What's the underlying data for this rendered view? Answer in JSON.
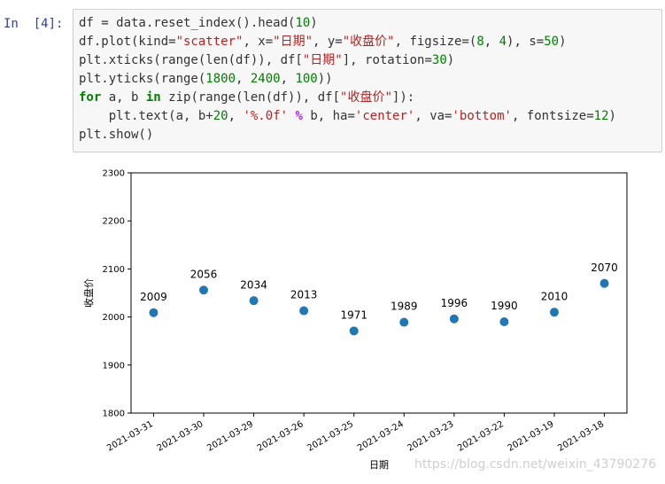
{
  "cell": {
    "prompt": "In  [4]:",
    "code_lines": [
      [
        [
          "df = data.reset_index().head(",
          "txt"
        ],
        [
          "10",
          "num"
        ],
        [
          ")",
          "txt"
        ]
      ],
      [
        [
          "df.plot(kind=",
          "txt"
        ],
        [
          "\"scatter\"",
          "str"
        ],
        [
          ", x=",
          "txt"
        ],
        [
          "\"日期\"",
          "str"
        ],
        [
          ", y=",
          "txt"
        ],
        [
          "\"收盘价\"",
          "str"
        ],
        [
          ", figsize=(",
          "txt"
        ],
        [
          "8",
          "num"
        ],
        [
          ", ",
          "txt"
        ],
        [
          "4",
          "num"
        ],
        [
          "), s=",
          "txt"
        ],
        [
          "50",
          "num"
        ],
        [
          ")",
          "txt"
        ]
      ],
      [
        [
          "plt.xticks(range(len(df)), df[",
          "txt"
        ],
        [
          "\"日期\"",
          "str"
        ],
        [
          "], rotation=",
          "txt"
        ],
        [
          "30",
          "num"
        ],
        [
          ")",
          "txt"
        ]
      ],
      [
        [
          "plt.yticks(range(",
          "txt"
        ],
        [
          "1800",
          "num"
        ],
        [
          ", ",
          "txt"
        ],
        [
          "2400",
          "num"
        ],
        [
          ", ",
          "txt"
        ],
        [
          "100",
          "num"
        ],
        [
          "))",
          "txt"
        ]
      ],
      [
        [
          "for",
          "kw"
        ],
        [
          " a, b ",
          "txt"
        ],
        [
          "in",
          "kw"
        ],
        [
          " zip(range(len(df)), df[",
          "txt"
        ],
        [
          "\"收盘价\"",
          "str"
        ],
        [
          "]):",
          "txt"
        ]
      ],
      [
        [
          "    plt.text(a, b+",
          "txt"
        ],
        [
          "20",
          "num"
        ],
        [
          ", ",
          "txt"
        ],
        [
          "'%.0f'",
          "str"
        ],
        [
          " ",
          "txt"
        ],
        [
          "%",
          "op"
        ],
        [
          " b, ha=",
          "txt"
        ],
        [
          "'center'",
          "str"
        ],
        [
          ", va=",
          "txt"
        ],
        [
          "'bottom'",
          "str"
        ],
        [
          ", fontsize=",
          "txt"
        ],
        [
          "12",
          "num"
        ],
        [
          ")",
          "txt"
        ]
      ],
      [
        [
          "plt.show()",
          "txt"
        ]
      ]
    ]
  },
  "chart_data": {
    "type": "scatter",
    "categories": [
      "2021-03-31",
      "2021-03-30",
      "2021-03-29",
      "2021-03-26",
      "2021-03-25",
      "2021-03-24",
      "2021-03-23",
      "2021-03-22",
      "2021-03-19",
      "2021-03-18"
    ],
    "values": [
      2009,
      2056,
      2034,
      2013,
      1971,
      1989,
      1996,
      1990,
      2010,
      2070
    ],
    "data_labels": [
      "2009",
      "2056",
      "2034",
      "2013",
      "1971",
      "1989",
      "1996",
      "1990",
      "2010",
      "2070"
    ],
    "yticks": [
      "1800",
      "1900",
      "2000",
      "2100",
      "2200",
      "2300"
    ],
    "ylim": [
      1800,
      2300
    ],
    "xlabel": "日期",
    "ylabel": "收盘价",
    "title": "",
    "marker_color": "#1f77b4",
    "grid": false,
    "x_rotation": 30
  },
  "watermark": "https://blog.csdn.net/weixin_43790276"
}
